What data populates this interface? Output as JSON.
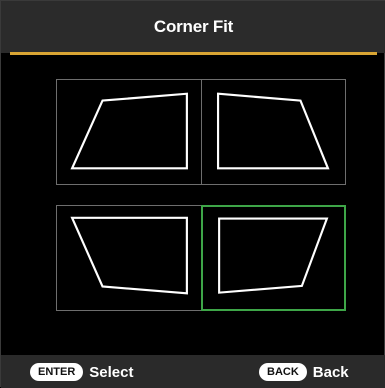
{
  "header": {
    "title": "Corner Fit"
  },
  "corner_options": [
    {
      "position": "top-left",
      "selected": false
    },
    {
      "position": "top-right",
      "selected": false
    },
    {
      "position": "bottom-left",
      "selected": false
    },
    {
      "position": "bottom-right",
      "selected": true
    }
  ],
  "footer": {
    "enter_key": "ENTER",
    "enter_label": "Select",
    "back_key": "BACK",
    "back_label": "Back"
  },
  "colors": {
    "accent": "#d9a534",
    "selection": "#3ea648",
    "background": "#000000",
    "bar": "#2b2b2b"
  }
}
